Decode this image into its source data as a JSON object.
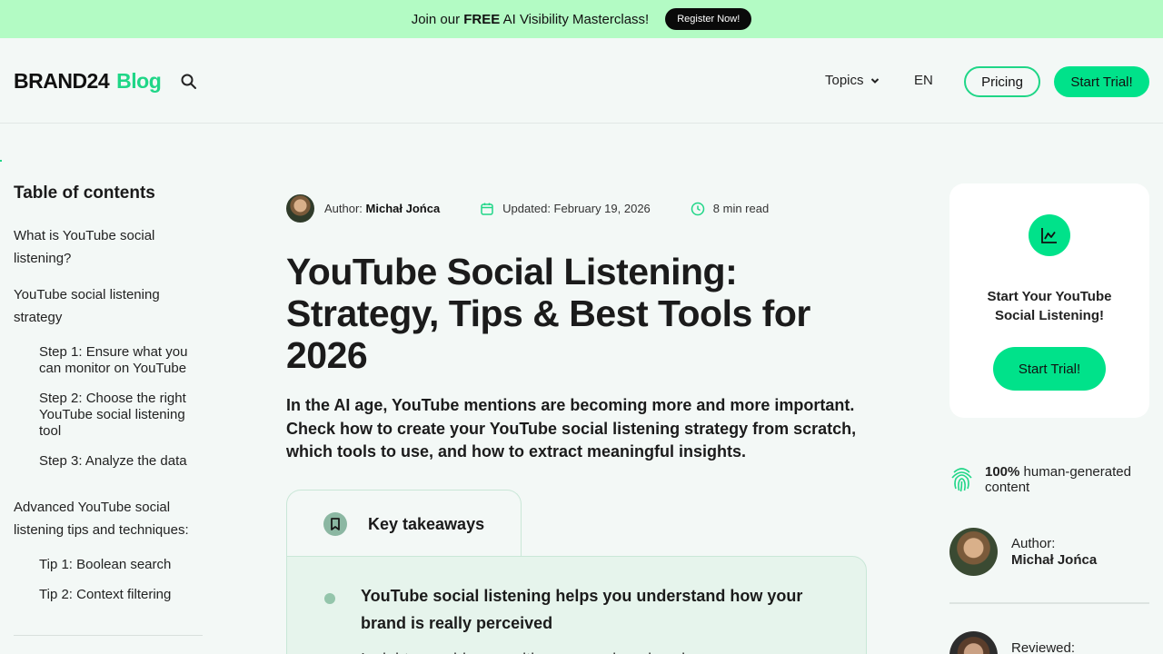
{
  "promo": {
    "text_pre": "Join our ",
    "text_bold": "FREE",
    "text_post": " AI Visibility Masterclass!",
    "button": "Register Now!"
  },
  "header": {
    "logo_brand": "BRAND24",
    "logo_blog": "Blog",
    "search_icon": "search-icon",
    "topics": "Topics",
    "lang": "EN",
    "pricing": "Pricing",
    "trial": "Start Trial!"
  },
  "toc": {
    "title": "Table of contents",
    "items": [
      "What is YouTube social listening?",
      "YouTube social listening strategy",
      "Step 1: Ensure what you can monitor on YouTube",
      "Step 2: Choose the right YouTube social listening tool",
      "Step 3: Analyze the data",
      "Advanced YouTube social listening tips and techniques:",
      "Tip 1: Boolean search",
      "Tip 2: Context filtering"
    ]
  },
  "article": {
    "author_label": "Author: ",
    "author_name": "Michał Jońca",
    "updated": "Updated: February 19, 2026",
    "read_time": "8 min read",
    "title": "YouTube Social Listening: Strategy, Tips & Best Tools for 2026",
    "lead": "In the AI age, YouTube mentions are becoming more and more important. Check how to create your YouTube social listening strategy from scratch, which tools to use, and how to extract meaningful insights.",
    "key_takeaways_title": "Key takeaways",
    "takeaway_1": "YouTube social listening helps you understand how your brand is really perceived",
    "takeaway_2": "Insights provide you with a comprehensive view"
  },
  "sidebar": {
    "cta_title": "Start Your YouTube Social Listening!",
    "cta_button": "Start Trial!",
    "human_bold": "100%",
    "human_text": " human-generated content",
    "author_label": "Author:",
    "author_name": "Michał Jońca",
    "reviewed_label": "Reviewed:"
  },
  "colors": {
    "accent": "#00e28a",
    "promo_bg": "#b3fbc4",
    "page_bg": "#f3f8f6"
  }
}
